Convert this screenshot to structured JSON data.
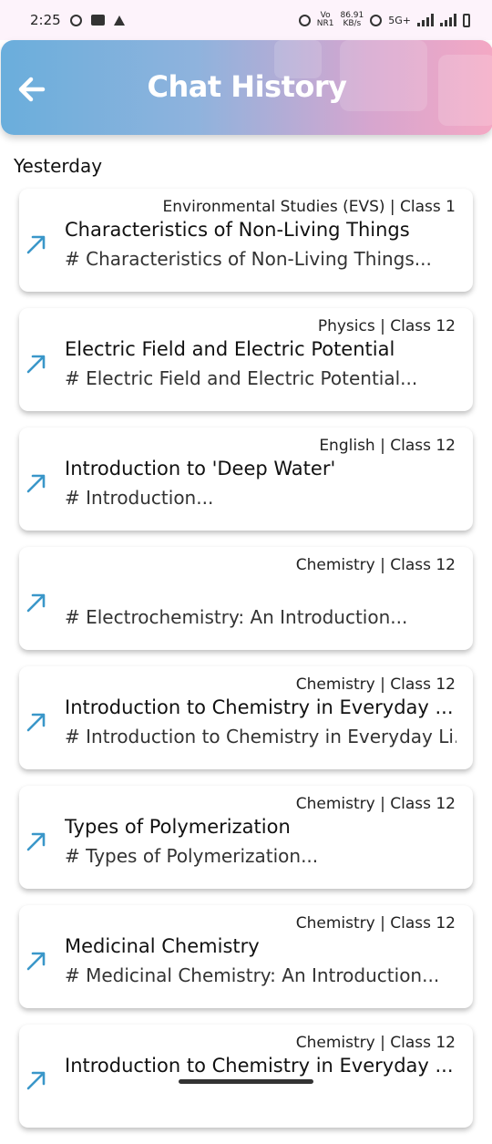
{
  "status_bar": {
    "time": "2:25",
    "net_speed_value": "86.91",
    "net_speed_unit": "KB/s",
    "network_type": "5G+",
    "volte_top": "Vo",
    "volte_bottom": "NR1"
  },
  "header": {
    "title": "Chat History",
    "back_icon": "arrow-left-icon",
    "gradient": [
      "#6aaedc",
      "#f4a8c4"
    ]
  },
  "section": {
    "label": "Yesterday"
  },
  "accent_color": "#3a97c9",
  "chats": [
    {
      "meta": "Environmental Studies (EVS) | Class 1",
      "title": "Characteristics of Non-Living Things",
      "preview": "# Characteristics of Non-Living Things..."
    },
    {
      "meta": "Physics | Class 12",
      "title": "Electric Field and Electric Potential",
      "preview": "# Electric Field and Electric Potential..."
    },
    {
      "meta": "English | Class 12",
      "title": "Introduction to 'Deep Water'",
      "preview": "# Introduction..."
    },
    {
      "meta": "Chemistry | Class 12",
      "title": "",
      "preview": "# Electrochemistry: An Introduction..."
    },
    {
      "meta": "Chemistry | Class 12",
      "title": "Introduction to Chemistry in Everyday ...",
      "preview": "# Introduction to Chemistry in Everyday Li..."
    },
    {
      "meta": "Chemistry | Class 12",
      "title": "Types of Polymerization",
      "preview": "# Types of Polymerization..."
    },
    {
      "meta": "Chemistry | Class 12",
      "title": "Medicinal Chemistry",
      "preview": "# Medicinal Chemistry: An Introduction..."
    },
    {
      "meta": "Chemistry | Class 12",
      "title": "Introduction to Chemistry in Everyday ...",
      "preview": ""
    }
  ]
}
